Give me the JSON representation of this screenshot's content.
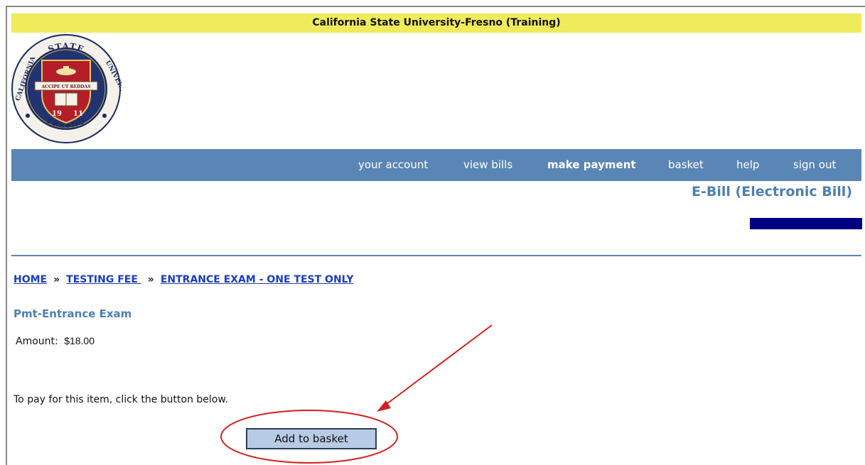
{
  "header": {
    "institution_title": "California State University-Fresno (Training)"
  },
  "seal": {
    "top_text": "STATE",
    "left_text": "CALIFORNIA",
    "right_text": "UNIVERSITY",
    "bottom_text": "FRESNO",
    "motto": "ACCIPE UT REDDAS",
    "year_left": "19",
    "year_right": "11"
  },
  "nav": {
    "items": [
      {
        "label": "your account"
      },
      {
        "label": "view bills"
      },
      {
        "label": "make payment"
      },
      {
        "label": "basket"
      },
      {
        "label": "help"
      },
      {
        "label": "sign out"
      }
    ],
    "active_index": 2
  },
  "app_name": "E-Bill (Electronic Bill)",
  "breadcrumb": {
    "items": [
      "HOME",
      "TESTING FEE ",
      "ENTRANCE EXAM - ONE TEST ONLY"
    ],
    "separator": "»"
  },
  "item": {
    "title": "Pmt-Entrance Exam",
    "amount_label": "Amount:",
    "amount_value": "$18.00"
  },
  "instruction": "To pay for this item, click the button below.",
  "add_button_label": "Add to basket",
  "colors": {
    "header_yellow": "#f0eb5a",
    "nav_blue": "#5a86b5",
    "title_blue": "#4d7fb0",
    "link_blue": "#1a3cc0",
    "dark_navy": "#000080",
    "button_fill": "#b8cbe4",
    "annotation_red": "#d42020",
    "seal_red": "#b41e28",
    "seal_navy": "#1c2a5e"
  }
}
